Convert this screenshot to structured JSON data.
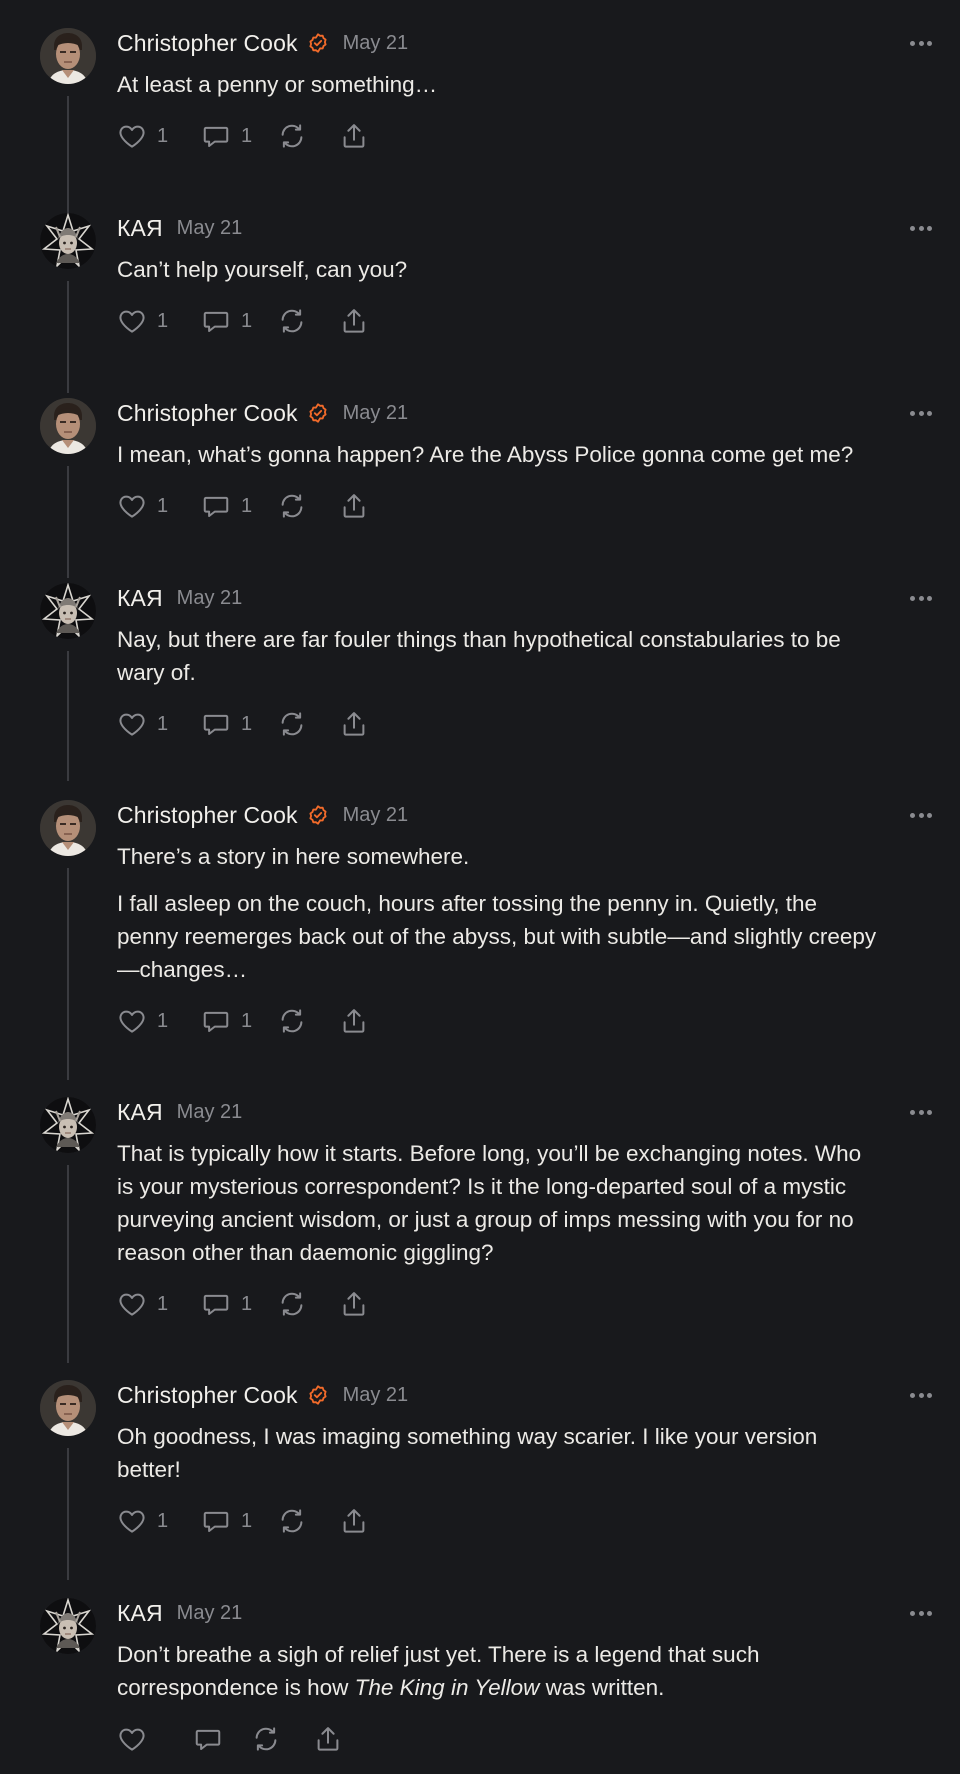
{
  "colors": {
    "background": "#18191c",
    "text": "#eceae6",
    "muted": "#8a8b90",
    "verified_accent": "#f26b2a",
    "thread_line": "#3a3b40"
  },
  "icons": {
    "like": "heart-icon",
    "comment": "comment-bubble-icon",
    "restack": "restack-icon",
    "share": "share-icon",
    "more": "more-options-icon",
    "verified": "verified-badge-icon"
  },
  "posts": [
    {
      "author": "Christopher Cook",
      "verified": true,
      "date": "May 21",
      "paragraphs": [
        "At least a penny or something…"
      ],
      "likes": "1",
      "comments": "1"
    },
    {
      "author": "КАЯ",
      "verified": false,
      "date": "May 21",
      "paragraphs": [
        "Can’t help yourself, can you?"
      ],
      "likes": "1",
      "comments": "1"
    },
    {
      "author": "Christopher Cook",
      "verified": true,
      "date": "May 21",
      "paragraphs": [
        "I mean, what’s gonna happen? Are the Abyss Police gonna come get me?"
      ],
      "likes": "1",
      "comments": "1"
    },
    {
      "author": "КАЯ",
      "verified": false,
      "date": "May 21",
      "paragraphs": [
        "Nay, but there are far fouler things than hypothetical constabularies to be wary of."
      ],
      "likes": "1",
      "comments": "1"
    },
    {
      "author": "Christopher Cook",
      "verified": true,
      "date": "May 21",
      "paragraphs": [
        "There’s a story in here somewhere.",
        "I fall asleep on the couch, hours after tossing the penny in. Quietly, the penny reemerges back out of the abyss, but with subtle—and slightly creepy—changes…"
      ],
      "likes": "1",
      "comments": "1"
    },
    {
      "author": "КАЯ",
      "verified": false,
      "date": "May 21",
      "paragraphs": [
        "That is typically how it starts. Before long, you’ll be exchanging notes. Who is your mysterious correspondent? Is it the long-departed soul of a mystic purveying ancient wisdom, or just a group of imps messing with you for no reason other than daemonic giggling?"
      ],
      "likes": "1",
      "comments": "1"
    },
    {
      "author": "Christopher Cook",
      "verified": true,
      "date": "May 21",
      "paragraphs": [
        "Oh goodness, I was imaging something way scarier. I like your version better!"
      ],
      "likes": "1",
      "comments": "1"
    },
    {
      "author": "КАЯ",
      "verified": false,
      "date": "May 21",
      "last_paragraph_parts": {
        "before": "Don’t breathe a sigh of relief just yet. There is a legend that such correspondence is how ",
        "title": "The King in Yellow",
        "after": " was written."
      },
      "likes": "",
      "comments": ""
    }
  ]
}
